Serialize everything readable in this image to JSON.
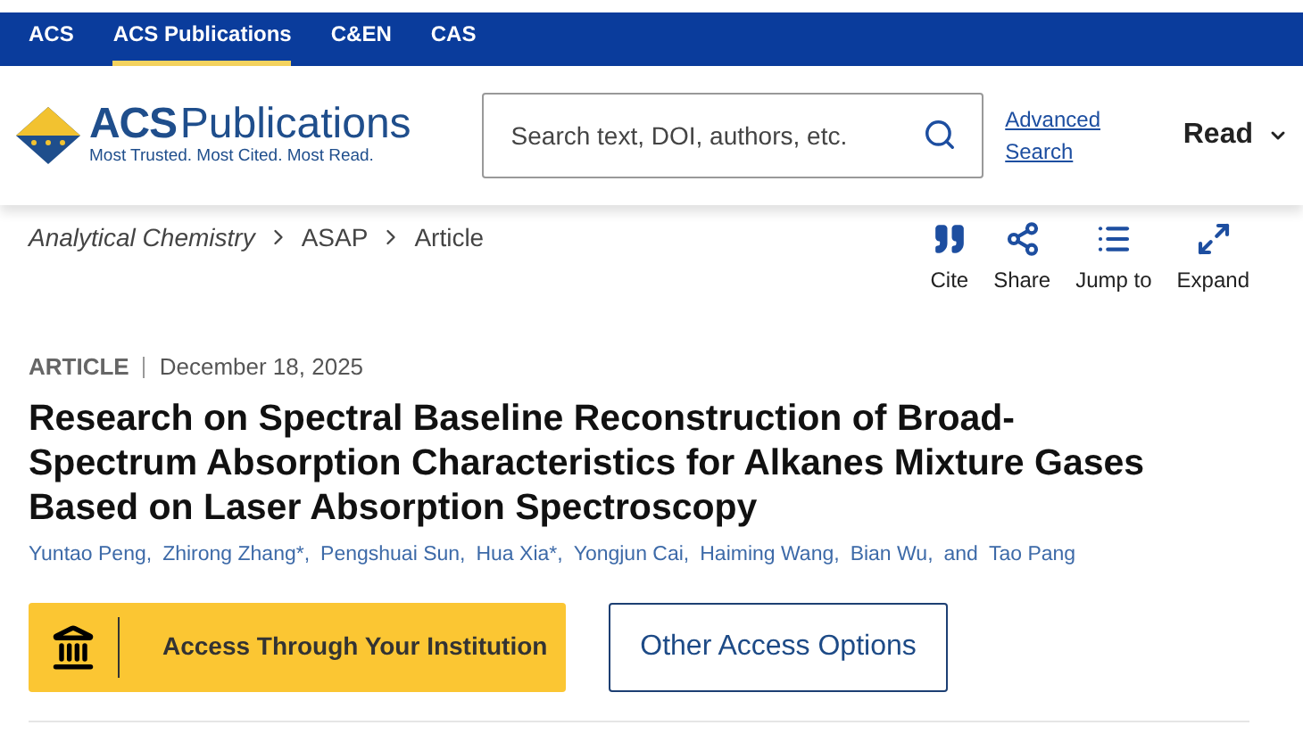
{
  "top_nav": [
    {
      "label": "ACS",
      "selected": false
    },
    {
      "label": "ACS Publications",
      "selected": true
    },
    {
      "label": "C&EN",
      "selected": false
    },
    {
      "label": "CAS",
      "selected": false
    }
  ],
  "logo": {
    "brand": "ACS",
    "name": "Publications",
    "tagline": "Most Trusted. Most Cited. Most Read."
  },
  "search": {
    "placeholder": "Search text, DOI, authors, etc."
  },
  "advanced_search": "Advanced Search",
  "read_menu": "Read",
  "breadcrumb": [
    "Analytical Chemistry",
    "ASAP",
    "Article"
  ],
  "tools": [
    {
      "kind": "cite",
      "label": "Cite"
    },
    {
      "kind": "share",
      "label": "Share"
    },
    {
      "kind": "jump",
      "label": "Jump to"
    },
    {
      "kind": "expand",
      "label": "Expand"
    }
  ],
  "article": {
    "type": "ARTICLE",
    "date": "December 18, 2025",
    "title": "Research on Spectral Baseline Reconstruction of Broad-Spectrum Absorption Characteristics for Alkanes Mixture Gases Based on Laser Absorption Spectroscopy"
  },
  "authors": [
    "Yuntao Peng,",
    "Zhirong Zhang*,",
    "Pengshuai Sun,",
    "Hua Xia*,",
    "Yongjun Cai,",
    "Haiming Wang,",
    "Bian Wu,",
    "Tao Pang"
  ],
  "authors_joiner": "and",
  "access_buttons": [
    {
      "kind": "institution",
      "label": "Access Through Your Institution"
    },
    {
      "kind": "other",
      "label": "Other Access Options"
    }
  ]
}
